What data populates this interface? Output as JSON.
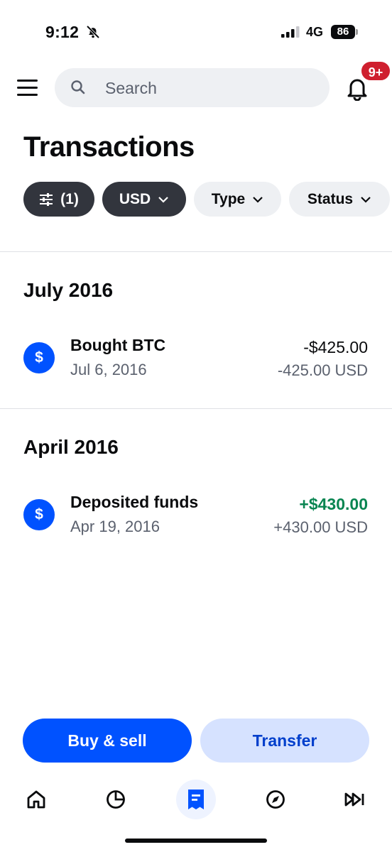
{
  "status_bar": {
    "time": "9:12",
    "network": "4G",
    "battery": "86",
    "icons": [
      "bell-off-icon",
      "signal-icon"
    ]
  },
  "header": {
    "search_placeholder": "Search",
    "notification_badge": "9+"
  },
  "page": {
    "title": "Transactions"
  },
  "filters": [
    {
      "label": "(1)",
      "icon": "sliders-icon",
      "style": "dark"
    },
    {
      "label": "USD",
      "icon": "chevron-down-icon",
      "style": "dark"
    },
    {
      "label": "Type",
      "icon": "chevron-down-icon",
      "style": "light"
    },
    {
      "label": "Status",
      "icon": "chevron-down-icon",
      "style": "light"
    }
  ],
  "sections": [
    {
      "title": "July 2016",
      "transactions": [
        {
          "icon": "$",
          "title": "Bought BTC",
          "date": "Jul 6, 2016",
          "amount": "-$425.00",
          "sub_amount": "-425.00 USD"
        }
      ]
    },
    {
      "title": "April 2016",
      "transactions": [
        {
          "icon": "$",
          "title": "Deposited funds",
          "date": "Apr 19, 2016",
          "amount": "+$430.00",
          "sub_amount": "+430.00 USD"
        }
      ]
    }
  ],
  "actions": {
    "primary": "Buy & sell",
    "secondary": "Transfer"
  },
  "tabs": [
    "home-icon",
    "portfolio-pie-icon",
    "transactions-icon",
    "explore-compass-icon",
    "trade-forward-icon"
  ],
  "colors": {
    "brand_blue": "#0052ff",
    "positive_green": "#098551",
    "badge_red": "#cf202f",
    "chip_dark": "#32353d",
    "surface_gray": "#eef0f3"
  }
}
